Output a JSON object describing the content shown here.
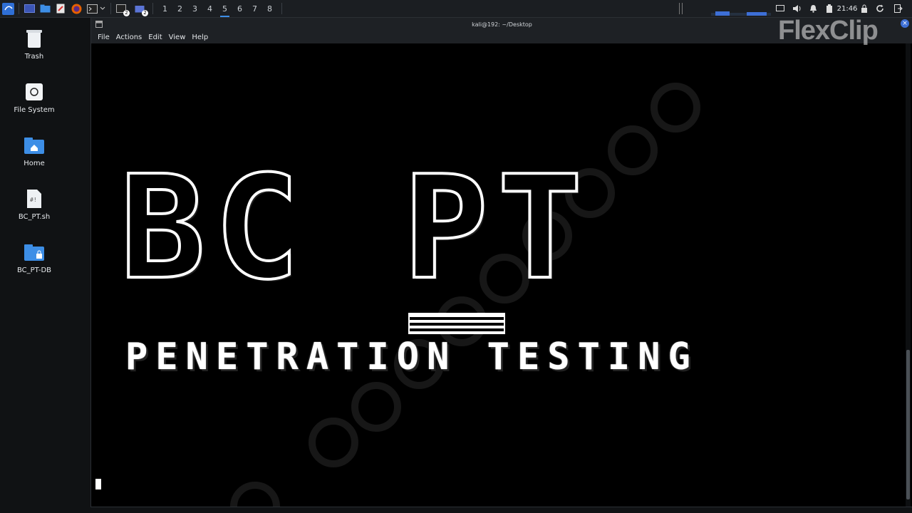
{
  "panel": {
    "workspaces": [
      "1",
      "2",
      "3",
      "4",
      "5",
      "6",
      "7",
      "8"
    ],
    "active_workspace": "5",
    "clock": "21:46",
    "window_badges": [
      "2",
      "2"
    ]
  },
  "desktop": {
    "icons": [
      {
        "label": "Trash",
        "icon": "trash-icon"
      },
      {
        "label": "File System",
        "icon": "drive-icon"
      },
      {
        "label": "Home",
        "icon": "home-folder-icon"
      },
      {
        "label": "BC_PT.sh",
        "icon": "script-file-icon"
      },
      {
        "label": "BC_PT-DB",
        "icon": "locked-folder-icon"
      }
    ]
  },
  "terminal": {
    "title": "kali@192: ~/Desktop",
    "menu": [
      "File",
      "Actions",
      "Edit",
      "View",
      "Help"
    ],
    "banner_big": "BC PT",
    "banner_sub": "PENETRATION TESTING"
  },
  "watermark": {
    "text": "FlexClip"
  },
  "colors": {
    "accent": "#3d8ee6",
    "panel_bg": "#1b1e22",
    "terminal_bg": "#000000"
  }
}
